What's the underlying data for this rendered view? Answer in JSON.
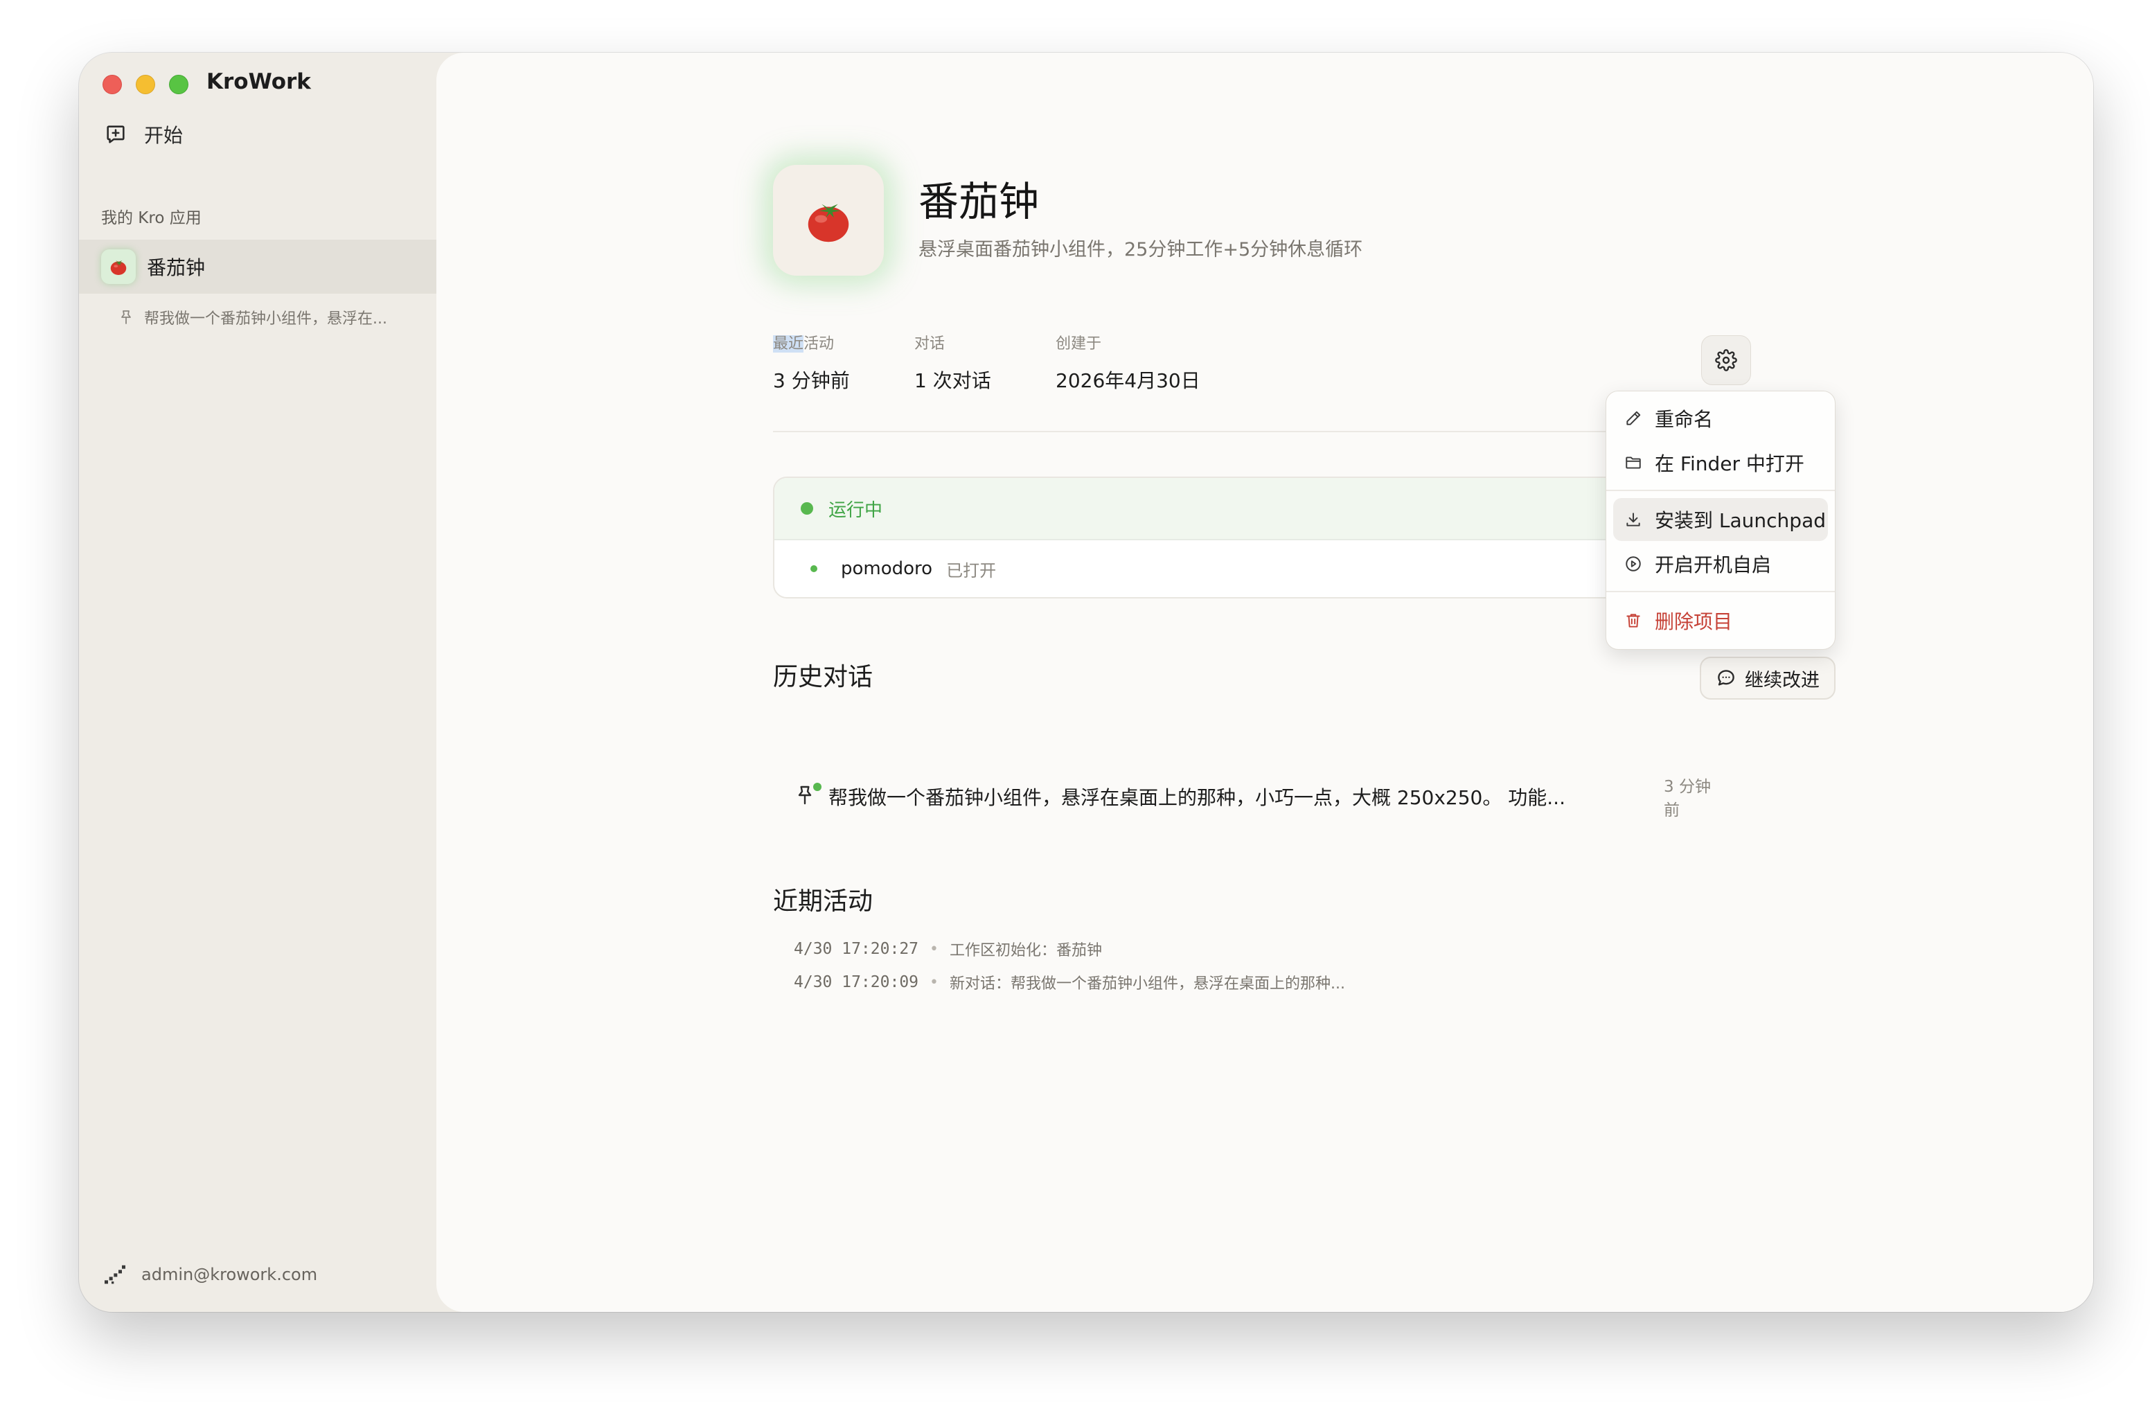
{
  "app": {
    "name": "KroWork"
  },
  "sidebar": {
    "new_label": "开始",
    "section_label": "我的 Kro 应用",
    "items": [
      {
        "label": "番茄钟",
        "sub": "帮我做一个番茄钟小组件，悬浮在..."
      }
    ],
    "user_email": "admin@krowork.com"
  },
  "project": {
    "icon": "tomato",
    "title": "番茄钟",
    "subtitle": "悬浮桌面番茄钟小组件，25分钟工作+5分钟休息循环",
    "stats": {
      "recent_label_hl": "最近",
      "recent_label_rest": "活动",
      "recent_value": "3 分钟前",
      "chats_label": "对话",
      "chats_value": "1 次对话",
      "created_label": "创建于",
      "created_value": "2026年4月30日"
    }
  },
  "run": {
    "status": "运行中",
    "process_name": "pomodoro",
    "process_state": "已打开"
  },
  "history": {
    "title": "历史对话",
    "continue_label": "继续改进",
    "items": [
      {
        "text": "帮我做一个番茄钟小组件，悬浮在桌面上的那种，小巧一点，大概 250x250。 功能...",
        "time": "3 分钟前"
      }
    ]
  },
  "activity": {
    "title": "近期活动",
    "items": [
      {
        "time": "4/30 17:20:27",
        "text": "工作区初始化：番茄钟"
      },
      {
        "time": "4/30 17:20:09",
        "text": "新对话：帮我做一个番茄钟小组件，悬浮在桌面上的那种..."
      }
    ]
  },
  "menu": {
    "rename": "重命名",
    "open_finder": "在 Finder 中打开",
    "install_launchpad": "安装到 Launchpad",
    "autostart": "开启开机自启",
    "delete": "删除项目"
  },
  "colors": {
    "accent_green": "#58b84f",
    "danger": "#c64237",
    "sidebar_bg": "#efece6",
    "main_bg": "#fbfaf8"
  }
}
